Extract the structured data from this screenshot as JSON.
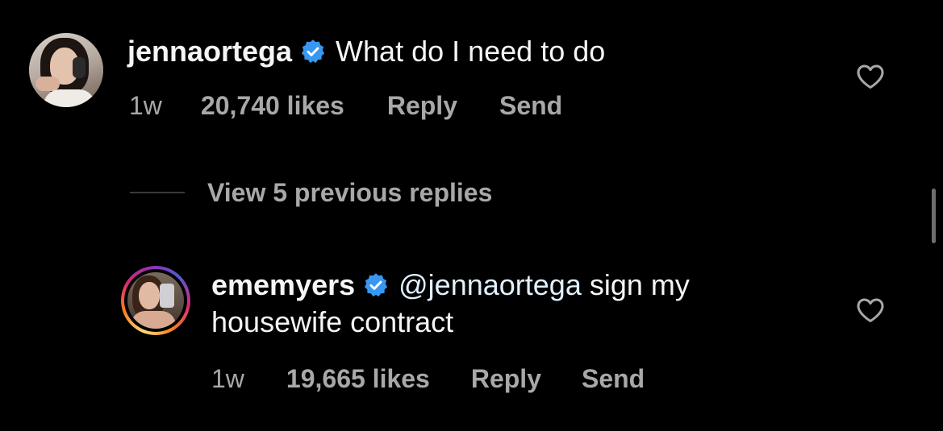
{
  "comments": [
    {
      "username": "jennaortega",
      "verified": true,
      "text": "What do I need to do",
      "time": "1w",
      "likes": "20,740 likes",
      "reply_label": "Reply",
      "send_label": "Send"
    },
    {
      "username": "ememyers",
      "verified": true,
      "mention": "@jennaortega",
      "text_line1_rest": " sign my",
      "text_line2": "housewife contract",
      "time": "1w",
      "likes": "19,665 likes",
      "reply_label": "Reply",
      "send_label": "Send"
    }
  ],
  "view_replies_label": "View 5 previous replies",
  "colors": {
    "background": "#000000",
    "primary_text": "#f5f5f5",
    "secondary_text": "#a8a8a8",
    "verified_badge": "#3897f0"
  },
  "icons": {
    "verified": "verified-badge-icon",
    "like": "heart-outline-icon"
  }
}
